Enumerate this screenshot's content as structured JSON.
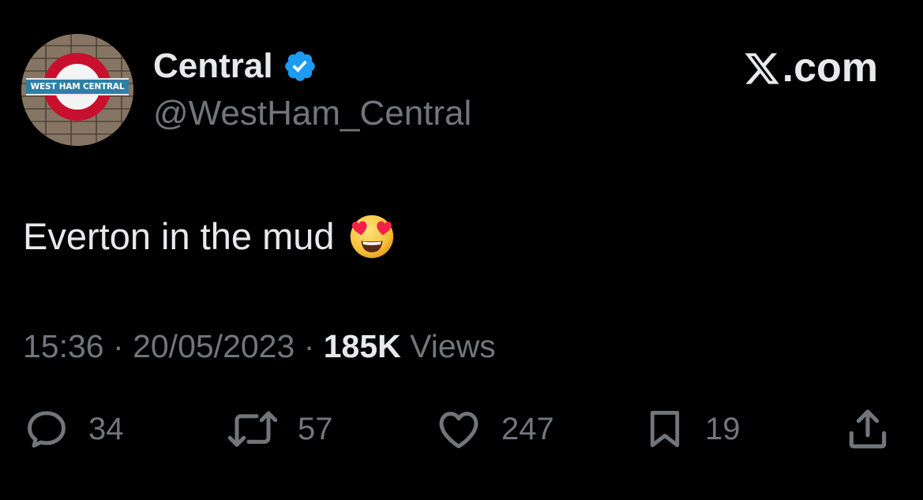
{
  "author": {
    "display_name": "Central",
    "handle": "@WestHam_Central",
    "verified": true,
    "avatar_sign_text": "WEST HAM CENTRAL"
  },
  "brand": {
    "label": ".com",
    "icon": "x-logo-icon"
  },
  "tweet": {
    "text": "Everton in the mud",
    "emoji": "heart-eyes-emoji"
  },
  "meta": {
    "time": "15:36",
    "separator": "·",
    "date": "20/05/2023",
    "views_count": "185K",
    "views_label": "Views"
  },
  "actions": {
    "replies": "34",
    "reposts": "57",
    "likes": "247",
    "bookmarks": "19"
  },
  "colors": {
    "background": "#000000",
    "primary_text": "#e7e9ea",
    "secondary_text": "#71767b",
    "verified_badge": "#1d9bf0"
  }
}
